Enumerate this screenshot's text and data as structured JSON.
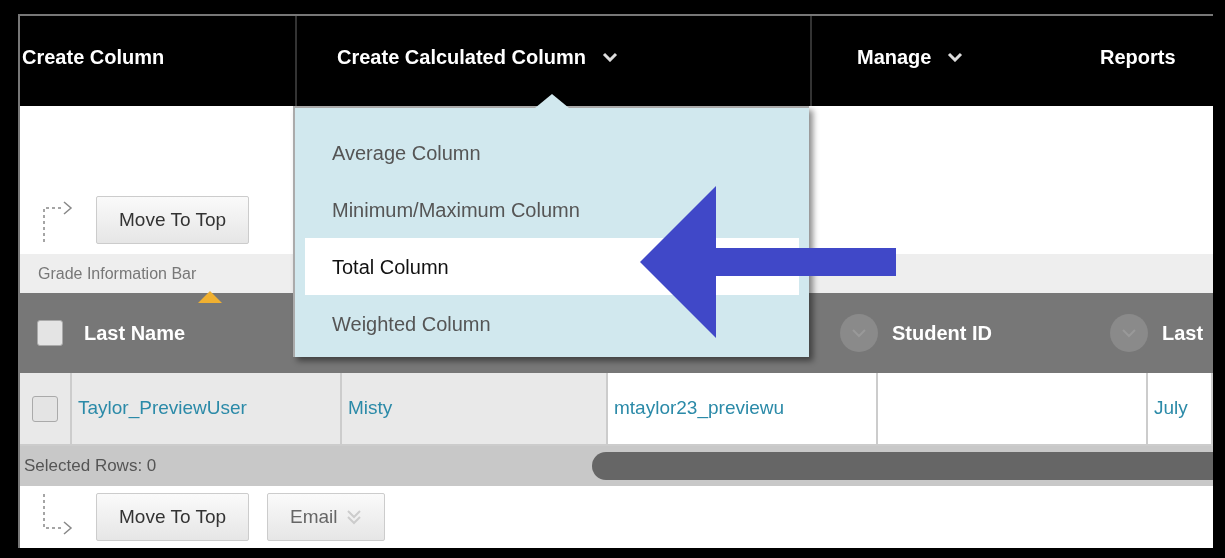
{
  "nav": [
    {
      "label": "Create Column",
      "has_menu": false
    },
    {
      "label": "Create Calculated Column",
      "has_menu": true
    },
    {
      "label": "Manage",
      "has_menu": true
    },
    {
      "label": "Reports",
      "has_menu": false
    }
  ],
  "dropdown": {
    "items": [
      {
        "label": "Average Column",
        "selected": false
      },
      {
        "label": "Minimum/Maximum Column",
        "selected": false
      },
      {
        "label": "Total Column",
        "selected": true
      },
      {
        "label": "Weighted Column",
        "selected": false
      }
    ]
  },
  "top_actions": [
    {
      "label": "Move To Top",
      "has_menu": false
    }
  ],
  "info_bar": "Grade Information Bar",
  "table": {
    "select_all_checked": false,
    "columns": [
      {
        "label": "Last Name",
        "sorted": true,
        "has_menu": false
      },
      {
        "label": "Student ID",
        "sorted": false,
        "has_menu": true
      },
      {
        "label": "Last",
        "sorted": false,
        "has_menu": true
      }
    ],
    "rows": [
      {
        "checked": false,
        "last_name": "Taylor_PreviewUser",
        "first_name": "Misty",
        "username": "mtaylor23_previewu",
        "column_5": "July"
      }
    ]
  },
  "selected_rows": "Selected Rows: 0",
  "bottom_actions": [
    {
      "label": "Move To Top",
      "has_menu": false
    },
    {
      "label": "Email",
      "has_menu": true
    }
  ]
}
